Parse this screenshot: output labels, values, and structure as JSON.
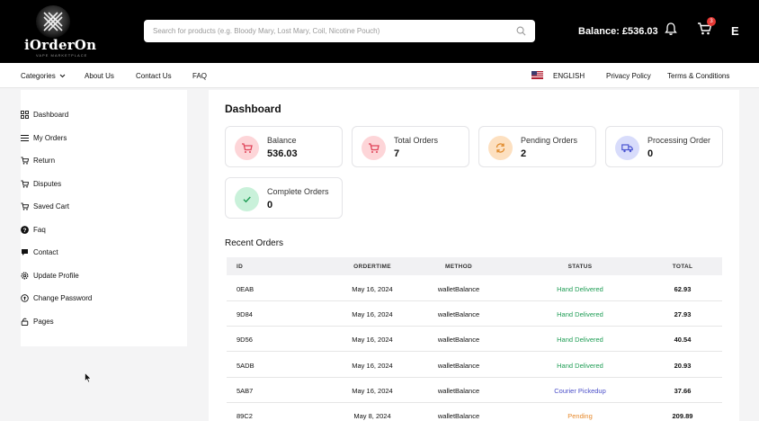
{
  "header": {
    "logo_text": "iOrderOn",
    "logo_tagline": "VAPE MARKETPLACE",
    "search_placeholder": "Search for products (e.g. Bloody Mary, Lost Mary, Coil, Nicotine Pouch)",
    "balance_label": "Balance: £536.03",
    "cart_count": "3",
    "user_initial": "E"
  },
  "navbar": {
    "categories": "Categories",
    "about": "About Us",
    "contact": "Contact Us",
    "faq": "FAQ",
    "language": "ENGLISH",
    "privacy": "Privacy Policy",
    "terms": "Terms & Conditions"
  },
  "sidebar": {
    "items": [
      {
        "label": "Dashboard",
        "icon": "grid-icon"
      },
      {
        "label": "My Orders",
        "icon": "list-icon"
      },
      {
        "label": "Return",
        "icon": "cart-icon"
      },
      {
        "label": "Disputes",
        "icon": "cart-icon"
      },
      {
        "label": "Saved Cart",
        "icon": "cart-icon"
      },
      {
        "label": "Faq",
        "icon": "question-icon"
      },
      {
        "label": "Contact",
        "icon": "chat-icon"
      },
      {
        "label": "Update Profile",
        "icon": "gear-icon"
      },
      {
        "label": "Change Password",
        "icon": "key-icon"
      },
      {
        "label": "Pages",
        "icon": "lock-icon"
      }
    ]
  },
  "main": {
    "title": "Dashboard",
    "cards": [
      {
        "label": "Balance",
        "value": "536.03",
        "color": "#fdd5d8",
        "icon_color": "#e0455a"
      },
      {
        "label": "Total Orders",
        "value": "7",
        "color": "#fdd5d8",
        "icon_color": "#e0455a"
      },
      {
        "label": "Pending Orders",
        "value": "2",
        "color": "#fde0c0",
        "icon_color": "#e08a2b"
      },
      {
        "label": "Processing Order",
        "value": "0",
        "color": "#d8dcfb",
        "icon_color": "#4b55d1"
      },
      {
        "label": "Complete Orders",
        "value": "0",
        "color": "#c9f1da",
        "icon_color": "#1f9d55"
      }
    ],
    "recent_title": "Recent Orders",
    "columns": [
      "ID",
      "ORDERTIME",
      "METHOD",
      "STATUS",
      "TOTAL"
    ],
    "orders": [
      {
        "id": "0EAB",
        "time": "May 16, 2024",
        "method": "walletBalance",
        "status": "Hand Delivered",
        "total": "62.93"
      },
      {
        "id": "9D84",
        "time": "May 16, 2024",
        "method": "walletBalance",
        "status": "Hand Delivered",
        "total": "27.93"
      },
      {
        "id": "9D56",
        "time": "May 16, 2024",
        "method": "walletBalance",
        "status": "Hand Delivered",
        "total": "40.54"
      },
      {
        "id": "5ADB",
        "time": "May 16, 2024",
        "method": "walletBalance",
        "status": "Hand Delivered",
        "total": "20.93"
      },
      {
        "id": "5AB7",
        "time": "May 16, 2024",
        "method": "walletBalance",
        "status": "Courier Pickedup",
        "total": "37.66"
      },
      {
        "id": "89C2",
        "time": "May 8, 2024",
        "method": "walletBalance",
        "status": "Pending",
        "total": "209.89"
      }
    ]
  }
}
